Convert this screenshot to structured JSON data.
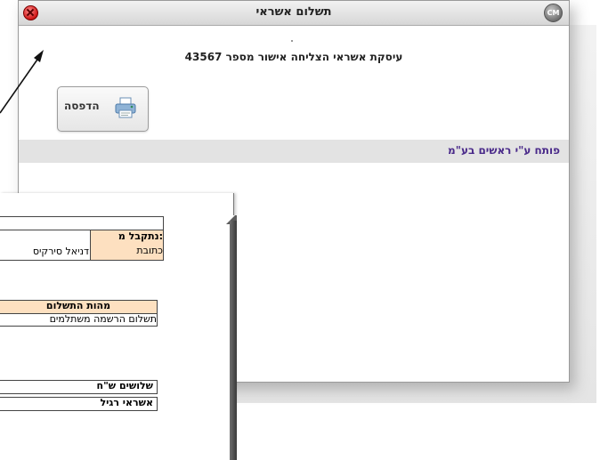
{
  "window": {
    "title": "תשלום אשראי",
    "status_message": "עיסקת אשראי הצליחה אישור מספר 43567",
    "app_badge": "CM"
  },
  "toolbar": {
    "print_label": "הדפסה"
  },
  "info_band": {
    "text": "פותח ע\"י ראשים בע\"מ"
  },
  "receipt": {
    "received_from_label": ":נתקבל מ",
    "received_from_value": "",
    "address_label": "כתובת",
    "address_value": "דניאל סירקיס",
    "payment_nature_header": "מהות התשלום",
    "payment_nature_value": "תשלום הרשמה משתלמים",
    "amount_words": "שלושים ש\"ח",
    "payment_type": "אשראי רגיל"
  },
  "colors": {
    "peach": "#fde0c0",
    "band_text": "#4a2a8a",
    "band_bg": "#e3e3e3"
  }
}
